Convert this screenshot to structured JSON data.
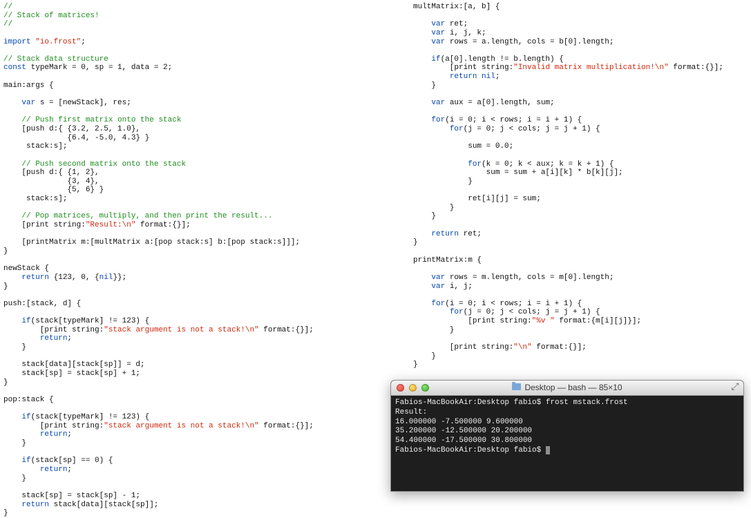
{
  "left_code": [
    {
      "cls": "comment",
      "txt": "//"
    },
    {
      "cls": "comment",
      "txt": "// Stack of matrices!"
    },
    {
      "cls": "comment",
      "txt": "//"
    },
    {
      "cls": "plain",
      "txt": ""
    },
    {
      "spans": [
        {
          "cls": "keyword",
          "txt": "import"
        },
        {
          "cls": "plain",
          "txt": " "
        },
        {
          "cls": "string",
          "txt": "\"io.frost\""
        },
        {
          "cls": "plain",
          "txt": ";"
        }
      ]
    },
    {
      "cls": "plain",
      "txt": ""
    },
    {
      "cls": "comment",
      "txt": "// Stack data structure"
    },
    {
      "spans": [
        {
          "cls": "keyword",
          "txt": "const"
        },
        {
          "cls": "plain",
          "txt": " typeMark = 0, sp = 1, data = 2;"
        }
      ]
    },
    {
      "cls": "plain",
      "txt": ""
    },
    {
      "cls": "plain",
      "txt": "main:args {"
    },
    {
      "cls": "plain",
      "txt": ""
    },
    {
      "spans": [
        {
          "cls": "plain",
          "txt": "    "
        },
        {
          "cls": "keyword",
          "txt": "var"
        },
        {
          "cls": "plain",
          "txt": " s = [newStack], res;"
        }
      ]
    },
    {
      "cls": "plain",
      "txt": ""
    },
    {
      "spans": [
        {
          "cls": "plain",
          "txt": "    "
        },
        {
          "cls": "comment",
          "txt": "// Push first matrix onto the stack"
        }
      ]
    },
    {
      "cls": "plain",
      "txt": "    [push d:{ {3.2, 2.5, 1.0},"
    },
    {
      "cls": "plain",
      "txt": "              {6.4, -5.0, 4.3} }"
    },
    {
      "cls": "plain",
      "txt": "     stack:s];"
    },
    {
      "cls": "plain",
      "txt": ""
    },
    {
      "spans": [
        {
          "cls": "plain",
          "txt": "    "
        },
        {
          "cls": "comment",
          "txt": "// Push second matrix onto the stack"
        }
      ]
    },
    {
      "cls": "plain",
      "txt": "    [push d:{ {1, 2},"
    },
    {
      "cls": "plain",
      "txt": "              {3, 4},"
    },
    {
      "cls": "plain",
      "txt": "              {5, 6} }"
    },
    {
      "cls": "plain",
      "txt": "     stack:s];"
    },
    {
      "cls": "plain",
      "txt": ""
    },
    {
      "spans": [
        {
          "cls": "plain",
          "txt": "    "
        },
        {
          "cls": "comment",
          "txt": "// Pop matrices, multiply, and then print the result..."
        }
      ]
    },
    {
      "spans": [
        {
          "cls": "plain",
          "txt": "    [print string:"
        },
        {
          "cls": "string",
          "txt": "\"Result:\\n\""
        },
        {
          "cls": "plain",
          "txt": " format:{}];"
        }
      ]
    },
    {
      "cls": "plain",
      "txt": ""
    },
    {
      "cls": "plain",
      "txt": "    [printMatrix m:[multMatrix a:[pop stack:s] b:[pop stack:s]]];"
    },
    {
      "cls": "plain",
      "txt": "}"
    },
    {
      "cls": "plain",
      "txt": ""
    },
    {
      "cls": "plain",
      "txt": "newStack {"
    },
    {
      "spans": [
        {
          "cls": "plain",
          "txt": "    "
        },
        {
          "cls": "keyword",
          "txt": "return"
        },
        {
          "cls": "plain",
          "txt": " {123, 0, {"
        },
        {
          "cls": "keyword",
          "txt": "nil"
        },
        {
          "cls": "plain",
          "txt": "}};"
        }
      ]
    },
    {
      "cls": "plain",
      "txt": "}"
    },
    {
      "cls": "plain",
      "txt": ""
    },
    {
      "cls": "plain",
      "txt": "push:[stack, d] {"
    },
    {
      "cls": "plain",
      "txt": ""
    },
    {
      "spans": [
        {
          "cls": "plain",
          "txt": "    "
        },
        {
          "cls": "keyword",
          "txt": "if"
        },
        {
          "cls": "plain",
          "txt": "(stack[typeMark] != 123) {"
        }
      ]
    },
    {
      "spans": [
        {
          "cls": "plain",
          "txt": "        [print string:"
        },
        {
          "cls": "string",
          "txt": "\"stack argument is not a stack!\\n\""
        },
        {
          "cls": "plain",
          "txt": " format:{}];"
        }
      ]
    },
    {
      "spans": [
        {
          "cls": "plain",
          "txt": "        "
        },
        {
          "cls": "keyword",
          "txt": "return"
        },
        {
          "cls": "plain",
          "txt": ";"
        }
      ]
    },
    {
      "cls": "plain",
      "txt": "    }"
    },
    {
      "cls": "plain",
      "txt": ""
    },
    {
      "cls": "plain",
      "txt": "    stack[data][stack[sp]] = d;"
    },
    {
      "cls": "plain",
      "txt": "    stack[sp] = stack[sp] + 1;"
    },
    {
      "cls": "plain",
      "txt": "}"
    },
    {
      "cls": "plain",
      "txt": ""
    },
    {
      "cls": "plain",
      "txt": "pop:stack {"
    },
    {
      "cls": "plain",
      "txt": ""
    },
    {
      "spans": [
        {
          "cls": "plain",
          "txt": "    "
        },
        {
          "cls": "keyword",
          "txt": "if"
        },
        {
          "cls": "plain",
          "txt": "(stack[typeMark] != 123) {"
        }
      ]
    },
    {
      "spans": [
        {
          "cls": "plain",
          "txt": "        [print string:"
        },
        {
          "cls": "string",
          "txt": "\"stack argument is not a stack!\\n\""
        },
        {
          "cls": "plain",
          "txt": " format:{}];"
        }
      ]
    },
    {
      "spans": [
        {
          "cls": "plain",
          "txt": "        "
        },
        {
          "cls": "keyword",
          "txt": "return"
        },
        {
          "cls": "plain",
          "txt": ";"
        }
      ]
    },
    {
      "cls": "plain",
      "txt": "    }"
    },
    {
      "cls": "plain",
      "txt": ""
    },
    {
      "spans": [
        {
          "cls": "plain",
          "txt": "    "
        },
        {
          "cls": "keyword",
          "txt": "if"
        },
        {
          "cls": "plain",
          "txt": "(stack[sp] == 0) {"
        }
      ]
    },
    {
      "spans": [
        {
          "cls": "plain",
          "txt": "        "
        },
        {
          "cls": "keyword",
          "txt": "return"
        },
        {
          "cls": "plain",
          "txt": ";"
        }
      ]
    },
    {
      "cls": "plain",
      "txt": "    }"
    },
    {
      "cls": "plain",
      "txt": ""
    },
    {
      "cls": "plain",
      "txt": "    stack[sp] = stack[sp] - 1;"
    },
    {
      "spans": [
        {
          "cls": "plain",
          "txt": "    "
        },
        {
          "cls": "keyword",
          "txt": "return"
        },
        {
          "cls": "plain",
          "txt": " stack[data][stack[sp]];"
        }
      ]
    },
    {
      "cls": "plain",
      "txt": "}"
    }
  ],
  "right_code": [
    {
      "cls": "plain",
      "txt": "multMatrix:[a, b] {"
    },
    {
      "cls": "plain",
      "txt": ""
    },
    {
      "spans": [
        {
          "cls": "plain",
          "txt": "    "
        },
        {
          "cls": "keyword",
          "txt": "var"
        },
        {
          "cls": "plain",
          "txt": " ret;"
        }
      ]
    },
    {
      "spans": [
        {
          "cls": "plain",
          "txt": "    "
        },
        {
          "cls": "keyword",
          "txt": "var"
        },
        {
          "cls": "plain",
          "txt": " i, j, k;"
        }
      ]
    },
    {
      "spans": [
        {
          "cls": "plain",
          "txt": "    "
        },
        {
          "cls": "keyword",
          "txt": "var"
        },
        {
          "cls": "plain",
          "txt": " rows = a.length, cols = b[0].length;"
        }
      ]
    },
    {
      "cls": "plain",
      "txt": ""
    },
    {
      "spans": [
        {
          "cls": "plain",
          "txt": "    "
        },
        {
          "cls": "keyword",
          "txt": "if"
        },
        {
          "cls": "plain",
          "txt": "(a[0].length != b.length) {"
        }
      ]
    },
    {
      "spans": [
        {
          "cls": "plain",
          "txt": "        [print string:"
        },
        {
          "cls": "string",
          "txt": "\"Invalid matrix multiplication!\\n\""
        },
        {
          "cls": "plain",
          "txt": " format:{}];"
        }
      ]
    },
    {
      "spans": [
        {
          "cls": "plain",
          "txt": "        "
        },
        {
          "cls": "keyword",
          "txt": "return nil"
        },
        {
          "cls": "plain",
          "txt": ";"
        }
      ]
    },
    {
      "cls": "plain",
      "txt": "    }"
    },
    {
      "cls": "plain",
      "txt": ""
    },
    {
      "spans": [
        {
          "cls": "plain",
          "txt": "    "
        },
        {
          "cls": "keyword",
          "txt": "var"
        },
        {
          "cls": "plain",
          "txt": " aux = a[0].length, sum;"
        }
      ]
    },
    {
      "cls": "plain",
      "txt": ""
    },
    {
      "spans": [
        {
          "cls": "plain",
          "txt": "    "
        },
        {
          "cls": "keyword",
          "txt": "for"
        },
        {
          "cls": "plain",
          "txt": "(i = 0; i < rows; i = i + 1) {"
        }
      ]
    },
    {
      "spans": [
        {
          "cls": "plain",
          "txt": "        "
        },
        {
          "cls": "keyword",
          "txt": "for"
        },
        {
          "cls": "plain",
          "txt": "(j = 0; j < cols; j = j + 1) {"
        }
      ]
    },
    {
      "cls": "plain",
      "txt": ""
    },
    {
      "cls": "plain",
      "txt": "            sum = 0.0;"
    },
    {
      "cls": "plain",
      "txt": ""
    },
    {
      "spans": [
        {
          "cls": "plain",
          "txt": "            "
        },
        {
          "cls": "keyword",
          "txt": "for"
        },
        {
          "cls": "plain",
          "txt": "(k = 0; k < aux; k = k + 1) {"
        }
      ]
    },
    {
      "cls": "plain",
      "txt": "                sum = sum + a[i][k] * b[k][j];"
    },
    {
      "cls": "plain",
      "txt": "            }"
    },
    {
      "cls": "plain",
      "txt": ""
    },
    {
      "cls": "plain",
      "txt": "            ret[i][j] = sum;"
    },
    {
      "cls": "plain",
      "txt": "        }"
    },
    {
      "cls": "plain",
      "txt": "    }"
    },
    {
      "cls": "plain",
      "txt": ""
    },
    {
      "spans": [
        {
          "cls": "plain",
          "txt": "    "
        },
        {
          "cls": "keyword",
          "txt": "return"
        },
        {
          "cls": "plain",
          "txt": " ret;"
        }
      ]
    },
    {
      "cls": "plain",
      "txt": "}"
    },
    {
      "cls": "plain",
      "txt": ""
    },
    {
      "cls": "plain",
      "txt": "printMatrix:m {"
    },
    {
      "cls": "plain",
      "txt": ""
    },
    {
      "spans": [
        {
          "cls": "plain",
          "txt": "    "
        },
        {
          "cls": "keyword",
          "txt": "var"
        },
        {
          "cls": "plain",
          "txt": " rows = m.length, cols = m[0].length;"
        }
      ]
    },
    {
      "spans": [
        {
          "cls": "plain",
          "txt": "    "
        },
        {
          "cls": "keyword",
          "txt": "var"
        },
        {
          "cls": "plain",
          "txt": " i, j;"
        }
      ]
    },
    {
      "cls": "plain",
      "txt": ""
    },
    {
      "spans": [
        {
          "cls": "plain",
          "txt": "    "
        },
        {
          "cls": "keyword",
          "txt": "for"
        },
        {
          "cls": "plain",
          "txt": "(i = 0; i < rows; i = i + 1) {"
        }
      ]
    },
    {
      "spans": [
        {
          "cls": "plain",
          "txt": "        "
        },
        {
          "cls": "keyword",
          "txt": "for"
        },
        {
          "cls": "plain",
          "txt": "(j = 0; j < cols; j = j + 1) {"
        }
      ]
    },
    {
      "spans": [
        {
          "cls": "plain",
          "txt": "            [print string:"
        },
        {
          "cls": "string",
          "txt": "\"%v \""
        },
        {
          "cls": "plain",
          "txt": " format:{m[i][j]}];"
        }
      ]
    },
    {
      "cls": "plain",
      "txt": "        }"
    },
    {
      "cls": "plain",
      "txt": ""
    },
    {
      "spans": [
        {
          "cls": "plain",
          "txt": "        [print string:"
        },
        {
          "cls": "string",
          "txt": "\"\\n\""
        },
        {
          "cls": "plain",
          "txt": " format:{}];"
        }
      ]
    },
    {
      "cls": "plain",
      "txt": "    }"
    },
    {
      "cls": "plain",
      "txt": "}"
    }
  ],
  "terminal": {
    "title": "Desktop — bash — 85×10",
    "lines": [
      "Fabios-MacBookAir:Desktop fabio$ frost mstack.frost",
      "Result:",
      "16.000000 -7.500000 9.600000 ",
      "35.200000 -12.500000 20.200000 ",
      "54.400000 -17.500000 30.800000 ",
      "Fabios-MacBookAir:Desktop fabio$ "
    ]
  }
}
